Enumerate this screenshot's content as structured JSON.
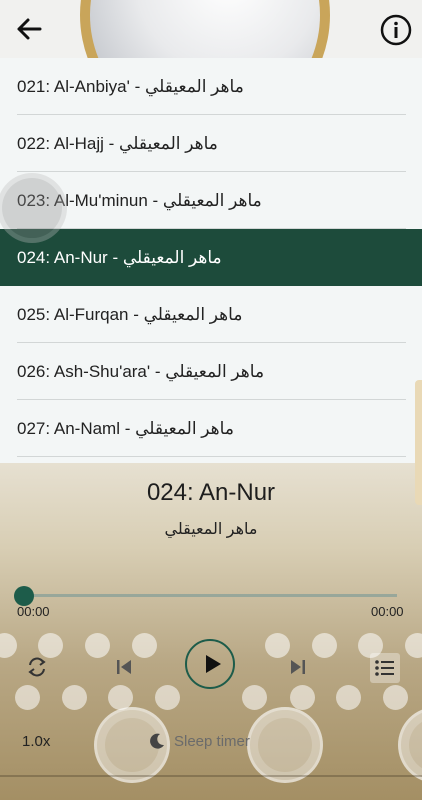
{
  "tracks": [
    {
      "label": "021: Al-Anbiya' - ماهر المعيقلي",
      "active": false
    },
    {
      "label": "022: Al-Hajj - ماهر المعيقلي",
      "active": false
    },
    {
      "label": "023: Al-Mu'minun - ماهر المعيقلي",
      "active": false
    },
    {
      "label": "024: An-Nur - ماهر المعيقلي",
      "active": true
    },
    {
      "label": "025: Al-Furqan - ماهر المعيقلي",
      "active": false
    },
    {
      "label": "026: Ash-Shu'ara' - ماهر المعيقلي",
      "active": false
    },
    {
      "label": "027: An-Naml - ماهر المعيقلي",
      "active": false
    }
  ],
  "player": {
    "title": "024: An-Nur",
    "reciter": "ماهر المعيقلي",
    "current_time": "00:00",
    "total_time": "00:00",
    "progress": 0,
    "speed": "1.0x",
    "sleep_label": "Sleep timer"
  },
  "icons": {
    "back": "arrow-left-icon",
    "info": "info-circle-icon",
    "repeat": "repeat-icon",
    "previous": "skip-previous-icon",
    "play": "play-icon",
    "next": "skip-next-icon",
    "playlist": "playlist-icon",
    "sleep": "moon-icon"
  },
  "colors": {
    "accent": "#1d4b3b",
    "progress": "#1d5c4a",
    "header_ring": "#c9a55a"
  }
}
